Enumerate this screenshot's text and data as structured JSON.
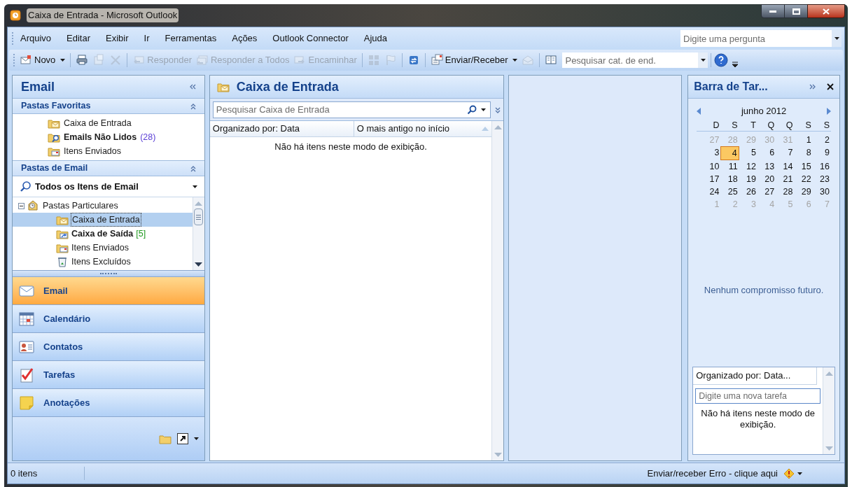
{
  "window": {
    "title": "Caixa de Entrada - Microsoft Outlook"
  },
  "menu": [
    "Arquivo",
    "Editar",
    "Exibir",
    "Ir",
    "Ferramentas",
    "Ações",
    "Outlook Connector",
    "Ajuda"
  ],
  "help_search": {
    "placeholder": "Digite uma pergunta"
  },
  "toolbar": [
    {
      "kind": "button",
      "label": "Novo",
      "dropdown": true,
      "disabled": false
    },
    {
      "kind": "separator"
    },
    {
      "kind": "icon",
      "disabled": false
    },
    {
      "kind": "icon",
      "disabled": true
    },
    {
      "kind": "icon",
      "disabled": true
    },
    {
      "kind": "separator"
    },
    {
      "kind": "button",
      "label": "Responder",
      "dropdown": false,
      "disabled": true
    },
    {
      "kind": "button",
      "label": "Responder a Todos",
      "dropdown": false,
      "disabled": true
    },
    {
      "kind": "button",
      "label": "Encaminhar",
      "dropdown": false,
      "disabled": true
    },
    {
      "kind": "separator"
    },
    {
      "kind": "icon",
      "disabled": true
    },
    {
      "kind": "icon",
      "disabled": true
    },
    {
      "kind": "separator"
    },
    {
      "kind": "icon",
      "disabled": false
    },
    {
      "kind": "separator"
    },
    {
      "kind": "button",
      "label": "Enviar/Receber",
      "dropdown": true,
      "disabled": false
    },
    {
      "kind": "icon",
      "disabled": true
    },
    {
      "kind": "separator"
    },
    {
      "kind": "icon",
      "disabled": false
    }
  ],
  "address_search": {
    "placeholder": "Pesquisar cat. de end."
  },
  "nav": {
    "title": "Email",
    "favorites": {
      "title": "Pastas Favoritas",
      "items": [
        {
          "label": "Caixa de Entrada",
          "bold": false
        },
        {
          "label": "Emails Não Lidos",
          "bold": true,
          "count": "(28)",
          "color": "#5b3fd6"
        },
        {
          "label": "Itens Enviados",
          "bold": false
        }
      ]
    },
    "mail_folders": {
      "title": "Pastas de Email",
      "view": "Todos os Itens de Email",
      "tree": [
        {
          "label": "Pastas Particulares",
          "bold": false,
          "selected": false,
          "expanded": true,
          "children": [
            {
              "label": "Caixa de Entrada",
              "bold": false,
              "selected": true
            },
            {
              "label": "Caixa de Saída",
              "bold": true,
              "selected": false,
              "count": "[5]",
              "color": "#1f9a1f"
            },
            {
              "label": "Itens Enviados",
              "bold": false,
              "selected": false
            },
            {
              "label": "Itens Excluídos",
              "bold": false,
              "selected": false
            }
          ]
        }
      ]
    },
    "buttons": [
      {
        "label": "Email",
        "selected": true
      },
      {
        "label": "Calendário",
        "selected": false
      },
      {
        "label": "Contatos",
        "selected": false
      },
      {
        "label": "Tarefas",
        "selected": false
      },
      {
        "label": "Anotações",
        "selected": false
      }
    ]
  },
  "inbox": {
    "title": "Caixa de Entrada",
    "search": {
      "placeholder": "Pesquisar Caixa de Entrada"
    },
    "columns": [
      "Organizado por: Data",
      "O mais antigo no início"
    ],
    "empty_text": "Não há itens neste modo de exibição."
  },
  "todo": {
    "title": "Barra de Tar...",
    "calendar": {
      "month": "junho 2012",
      "weekdays": [
        "D",
        "S",
        "T",
        "Q",
        "Q",
        "S",
        "S"
      ],
      "weeks": [
        [
          {
            "day": "27",
            "other_month": true,
            "selected": false
          },
          {
            "day": "28",
            "other_month": true,
            "selected": false
          },
          {
            "day": "29",
            "other_month": true,
            "selected": false
          },
          {
            "day": "30",
            "other_month": true,
            "selected": false
          },
          {
            "day": "31",
            "other_month": true,
            "selected": false
          },
          {
            "day": "1",
            "other_month": false,
            "selected": false
          },
          {
            "day": "2",
            "other_month": false,
            "selected": false
          }
        ],
        [
          {
            "day": "3",
            "other_month": false,
            "selected": false
          },
          {
            "day": "4",
            "other_month": false,
            "selected": true
          },
          {
            "day": "5",
            "other_month": false,
            "selected": false
          },
          {
            "day": "6",
            "other_month": false,
            "selected": false
          },
          {
            "day": "7",
            "other_month": false,
            "selected": false
          },
          {
            "day": "8",
            "other_month": false,
            "selected": false
          },
          {
            "day": "9",
            "other_month": false,
            "selected": false
          }
        ],
        [
          {
            "day": "10",
            "other_month": false,
            "selected": false
          },
          {
            "day": "11",
            "other_month": false,
            "selected": false
          },
          {
            "day": "12",
            "other_month": false,
            "selected": false
          },
          {
            "day": "13",
            "other_month": false,
            "selected": false
          },
          {
            "day": "14",
            "other_month": false,
            "selected": false
          },
          {
            "day": "15",
            "other_month": false,
            "selected": false
          },
          {
            "day": "16",
            "other_month": false,
            "selected": false
          }
        ],
        [
          {
            "day": "17",
            "other_month": false,
            "selected": false
          },
          {
            "day": "18",
            "other_month": false,
            "selected": false
          },
          {
            "day": "19",
            "other_month": false,
            "selected": false
          },
          {
            "day": "20",
            "other_month": false,
            "selected": false
          },
          {
            "day": "21",
            "other_month": false,
            "selected": false
          },
          {
            "day": "22",
            "other_month": false,
            "selected": false
          },
          {
            "day": "23",
            "other_month": false,
            "selected": false
          }
        ],
        [
          {
            "day": "24",
            "other_month": false,
            "selected": false
          },
          {
            "day": "25",
            "other_month": false,
            "selected": false
          },
          {
            "day": "26",
            "other_month": false,
            "selected": false
          },
          {
            "day": "27",
            "other_month": false,
            "selected": false
          },
          {
            "day": "28",
            "other_month": false,
            "selected": false
          },
          {
            "day": "29",
            "other_month": false,
            "selected": false
          },
          {
            "day": "30",
            "other_month": false,
            "selected": false
          }
        ],
        [
          {
            "day": "1",
            "other_month": true,
            "selected": false
          },
          {
            "day": "2",
            "other_month": true,
            "selected": false
          },
          {
            "day": "3",
            "other_month": true,
            "selected": false
          },
          {
            "day": "4",
            "other_month": true,
            "selected": false
          },
          {
            "day": "5",
            "other_month": true,
            "selected": false
          },
          {
            "day": "6",
            "other_month": true,
            "selected": false
          },
          {
            "day": "7",
            "other_month": true,
            "selected": false
          }
        ]
      ]
    },
    "appointments_text": "Nenhum compromisso futuro.",
    "tasks": {
      "column": "Organizado por: Data...",
      "new_task": {
        "placeholder": "Digite uma nova tarefa"
      },
      "empty_text": "Não há itens neste modo de exibição."
    }
  },
  "status_bar": {
    "left": "0 itens",
    "right": "Enviar/receber Erro - clique aqui"
  }
}
